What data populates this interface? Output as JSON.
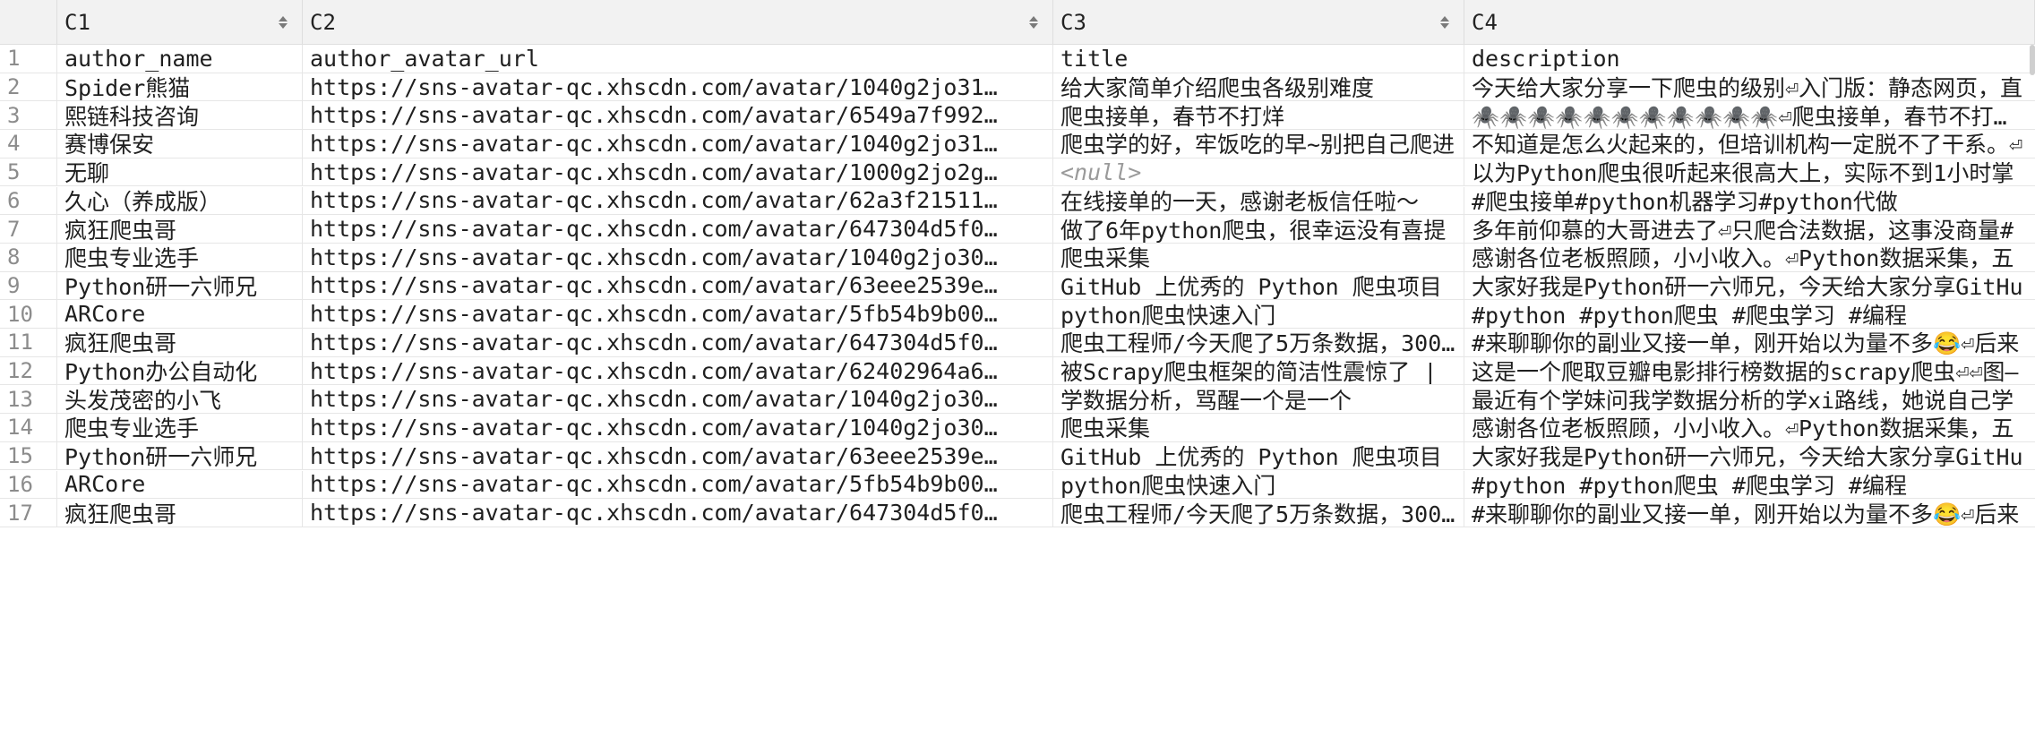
{
  "columns": [
    {
      "id": "C1"
    },
    {
      "id": "C2"
    },
    {
      "id": "C3"
    },
    {
      "id": "C4"
    }
  ],
  "rows": [
    {
      "n": "1",
      "c1": "author_name",
      "c2": "author_avatar_url",
      "c3": "title",
      "c4": "description"
    },
    {
      "n": "2",
      "c1": "Spider熊猫",
      "c2": "https://sns-avatar-qc.xhscdn.com/avatar/1040g2jo31…",
      "c3": "给大家简单介绍爬虫各级别难度",
      "c4": "今天给大家分享一下爬虫的级别⏎入门版：静态网页，直"
    },
    {
      "n": "3",
      "c1": "熙链科技咨询",
      "c2": "https://sns-avatar-qc.xhscdn.com/avatar/6549a7f992…",
      "c3": "爬虫接单，春节不打烊",
      "c4": "🕷️🕷️🕷️🕷️🕷️🕷️🕷️🕷️🕷️🕷️🕷️⏎爬虫接单，春节不打烊，"
    },
    {
      "n": "4",
      "c1": "赛博保安",
      "c2": "https://sns-avatar-qc.xhscdn.com/avatar/1040g2jo31…",
      "c3": "爬虫学的好，牢饭吃的早~别把自己爬进",
      "c4": "不知道是怎么火起来的，但培训机构一定脱不了干系。⏎"
    },
    {
      "n": "5",
      "c1": "无聊",
      "c2": "https://sns-avatar-qc.xhscdn.com/avatar/1000g2jo2g…",
      "c3": "<null>",
      "c4": "以为Python爬虫很听起来很高大上，实际不到1小时掌"
    },
    {
      "n": "6",
      "c1": "久心（养成版）",
      "c2": "https://sns-avatar-qc.xhscdn.com/avatar/62a3f21511…",
      "c3": "在线接单的一天，感谢老板信任啦～",
      "c4": "#爬虫接单#python机器学习#python代做"
    },
    {
      "n": "7",
      "c1": "疯狂爬虫哥",
      "c2": "https://sns-avatar-qc.xhscdn.com/avatar/647304d5f0…",
      "c3": "做了6年python爬虫，很幸运没有喜提",
      "c4": "多年前仰慕的大哥进去了⏎只爬合法数据，这事没商量#"
    },
    {
      "n": "8",
      "c1": "爬虫专业选手",
      "c2": "https://sns-avatar-qc.xhscdn.com/avatar/1040g2jo30…",
      "c3": "爬虫采集",
      "c4": "感谢各位老板照顾，小小收入。⏎Python数据采集，五"
    },
    {
      "n": "9",
      "c1": "Python研一六师兄",
      "c2": "https://sns-avatar-qc.xhscdn.com/avatar/63eee2539e…",
      "c3": "GitHub 上优秀的 Python 爬虫项目",
      "c4": "大家好我是Python研一六师兄，今天给大家分享GitHu"
    },
    {
      "n": "10",
      "c1": "ARCore",
      "c2": "https://sns-avatar-qc.xhscdn.com/avatar/5fb54b9b00…",
      "c3": "python爬虫快速入门",
      "c4": "#python  #python爬虫  #爬虫学习  #编程"
    },
    {
      "n": "11",
      "c1": "疯狂爬虫哥",
      "c2": "https://sns-avatar-qc.xhscdn.com/avatar/647304d5f0…",
      "c3": "爬虫工程师/今天爬了5万条数据，300元",
      "c4": "#来聊聊你的副业又接一单，刚开始以为量不多😂⏎后来"
    },
    {
      "n": "12",
      "c1": "Python办公自动化",
      "c2": "https://sns-avatar-qc.xhscdn.com/avatar/62402964a6…",
      "c3": "被Scrapy爬虫框架的简洁性震惊了 |",
      "c4": "这是一个爬取豆瓣电影排行榜数据的scrapy爬虫⏎⏎图—"
    },
    {
      "n": "13",
      "c1": "头发茂密的小飞",
      "c2": "https://sns-avatar-qc.xhscdn.com/avatar/1040g2jo30…",
      "c3": "学数据分析，骂醒一个是一个",
      "c4": "最近有个学妹问我学数据分析的学xi路线，她说自己学"
    },
    {
      "n": "14",
      "c1": "爬虫专业选手",
      "c2": "https://sns-avatar-qc.xhscdn.com/avatar/1040g2jo30…",
      "c3": "爬虫采集",
      "c4": "感谢各位老板照顾，小小收入。⏎Python数据采集，五"
    },
    {
      "n": "15",
      "c1": "Python研一六师兄",
      "c2": "https://sns-avatar-qc.xhscdn.com/avatar/63eee2539e…",
      "c3": "GitHub 上优秀的 Python 爬虫项目",
      "c4": "大家好我是Python研一六师兄，今天给大家分享GitHu"
    },
    {
      "n": "16",
      "c1": "ARCore",
      "c2": "https://sns-avatar-qc.xhscdn.com/avatar/5fb54b9b00…",
      "c3": "python爬虫快速入门",
      "c4": "#python  #python爬虫  #爬虫学习  #编程"
    },
    {
      "n": "17",
      "c1": "疯狂爬虫哥",
      "c2": "https://sns-avatar-qc.xhscdn.com/avatar/647304d5f0…",
      "c3": "爬虫工程师/今天爬了5万条数据，300元",
      "c4": "#来聊聊你的副业又接一单，刚开始以为量不多😂⏎后来"
    }
  ]
}
